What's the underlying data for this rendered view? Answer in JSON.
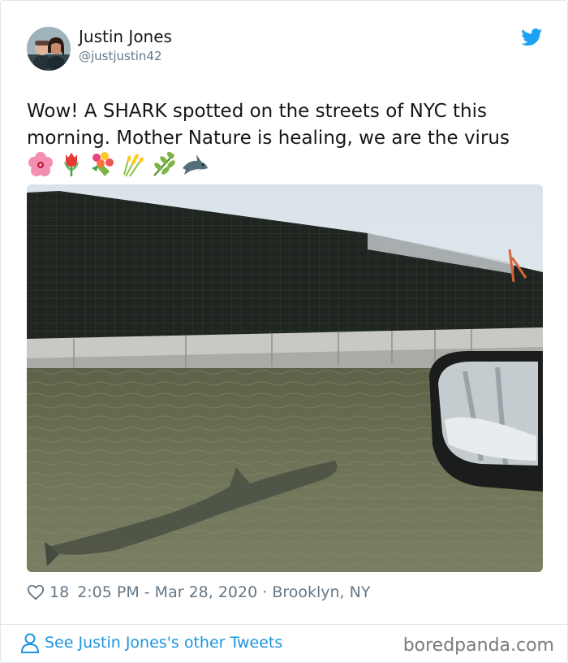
{
  "tweet": {
    "author_name": "Justin Jones",
    "author_handle": "@justjustin42",
    "text": "Wow! A SHARK spotted on the streets of NYC this morning. Mother Nature is healing, we are the virus",
    "emojis": [
      "hibiscus",
      "tulip",
      "bouquet",
      "wheat",
      "herb",
      "shark"
    ],
    "like_count": "18",
    "timestamp": "2:05 PM - Mar 28, 2020",
    "separator": " · ",
    "location": "Brooklyn, NY",
    "see_others_link": "See Justin Jones's other Tweets"
  },
  "watermark": "boredpanda.com",
  "icons": {
    "brand": "twitter-bird-icon",
    "like": "heart-icon",
    "profile": "person-icon"
  },
  "colors": {
    "twitter_blue": "#1da1f2",
    "link_blue": "#1b95e0",
    "text_primary": "#14171a",
    "text_secondary": "#657786"
  }
}
